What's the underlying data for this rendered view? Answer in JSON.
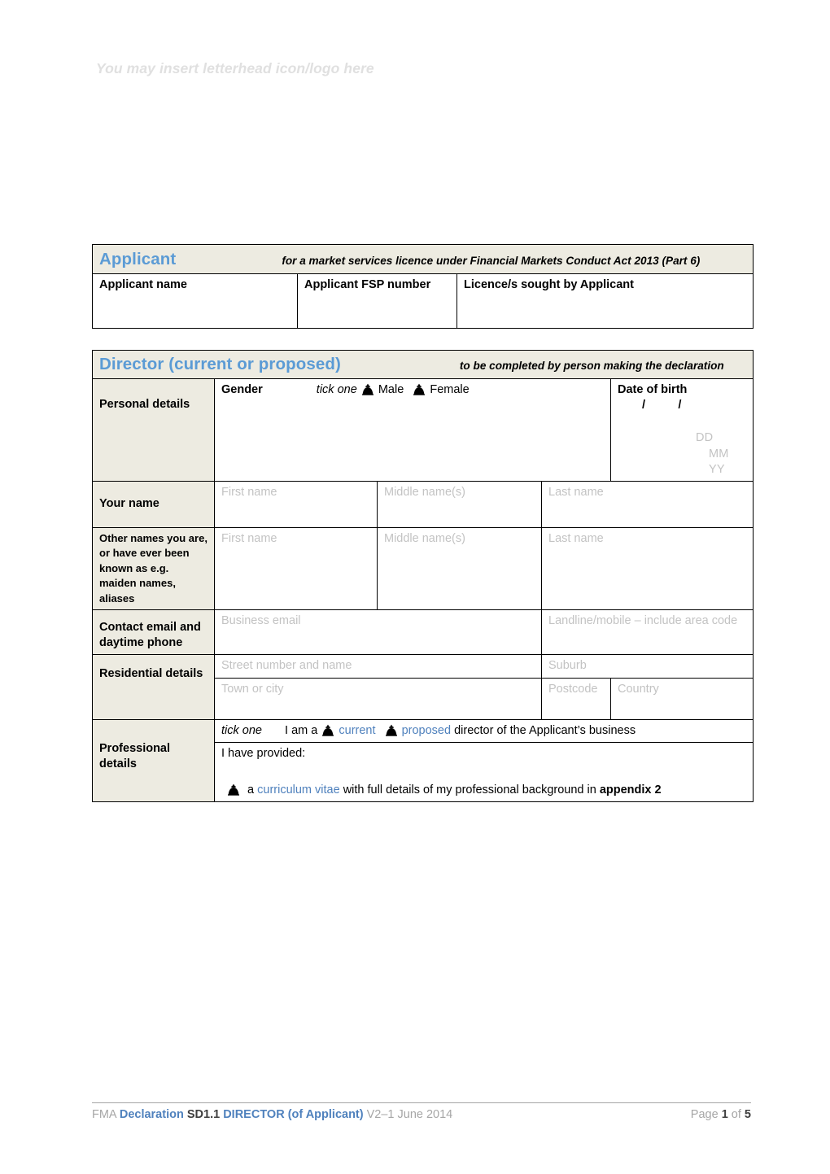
{
  "letterhead": {
    "text": "You may insert letterhead icon/logo here"
  },
  "colors": {
    "heading_blue": "#5b9bd5",
    "link_blue": "#4f81bd",
    "band_beige": "#edebe1",
    "placeholder_grey": "#c3c3c3",
    "footer_grey": "#a6a6a6"
  },
  "applicant": {
    "band_title": "Applicant",
    "band_subtitle": "for a market services licence under Financial Markets Conduct Act 2013 (Part 6)",
    "fields": [
      {
        "label": "Applicant name",
        "value": ""
      },
      {
        "label": "Applicant FSP number",
        "value": ""
      },
      {
        "label": "Licence/s sought by Applicant",
        "value": ""
      }
    ]
  },
  "director": {
    "band_title": "Director  (current or proposed)",
    "band_subtitle": "to be completed by person making the declaration",
    "rows": {
      "personal_details_label": "Personal details",
      "gender_label": "Gender",
      "tick_one": "tick one",
      "gender_options": [
        "Male",
        "Female"
      ],
      "dob_label": "Date of birth",
      "dob_slashes": "/          /",
      "dob_hints": [
        "DD",
        "MM",
        "YY"
      ],
      "your_name_label": "Your name",
      "name_placeholders": [
        "First name",
        "Middle name(s)",
        "Last name"
      ],
      "other_names_label": "Other names you are, or have ever been known as e.g. maiden names, aliases",
      "contact_label": "Contact email and daytime phone",
      "contact_placeholders": [
        "Business email",
        "Landline/mobile – include area code"
      ],
      "residential_label": "Residential details",
      "residential_placeholders": [
        "Street number and name",
        "Suburb",
        "Town or city",
        "Postcode",
        "Country"
      ],
      "professional_label": "Professional details",
      "professional_tick_one": "tick one",
      "professional_lead": "I am a",
      "professional_option_current": "current",
      "professional_option_proposed": "proposed",
      "professional_tail": "director of the Applicant’s business",
      "provided_intro": "I have provided:",
      "provided_item_a": "a",
      "provided_item_link": "curriculum vitae",
      "provided_item_mid": "with full details of my professional background in",
      "provided_item_bold": "appendix 2"
    }
  },
  "footer": {
    "org": "FMA",
    "doc_type": "Declaration",
    "doc_code": "SD1.1",
    "doc_role": "DIRECTOR (of Applicant)",
    "version": "V2–1 June 2014",
    "page_word": "Page",
    "page_number": "1",
    "of_word": "of",
    "page_total": "5"
  }
}
